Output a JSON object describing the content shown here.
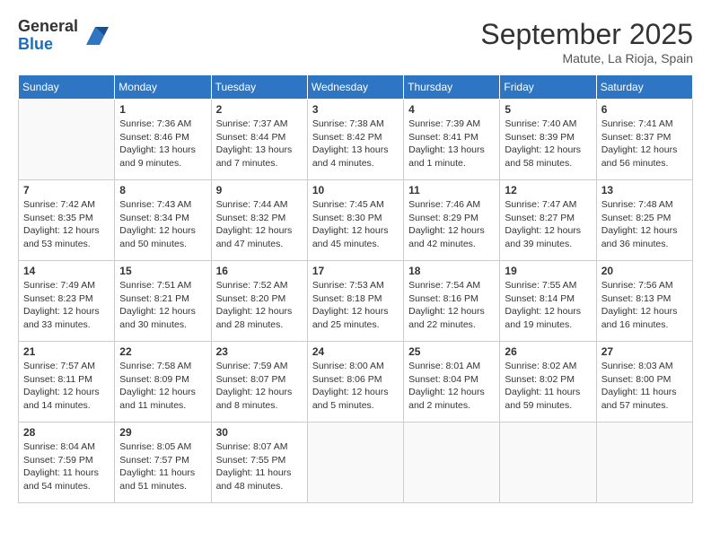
{
  "header": {
    "logo_general": "General",
    "logo_blue": "Blue",
    "month_title": "September 2025",
    "location": "Matute, La Rioja, Spain"
  },
  "calendar": {
    "days_of_week": [
      "Sunday",
      "Monday",
      "Tuesday",
      "Wednesday",
      "Thursday",
      "Friday",
      "Saturday"
    ],
    "weeks": [
      [
        {
          "day": "",
          "empty": true
        },
        {
          "day": "1",
          "sunrise": "Sunrise: 7:36 AM",
          "sunset": "Sunset: 8:46 PM",
          "daylight": "Daylight: 13 hours and 9 minutes."
        },
        {
          "day": "2",
          "sunrise": "Sunrise: 7:37 AM",
          "sunset": "Sunset: 8:44 PM",
          "daylight": "Daylight: 13 hours and 7 minutes."
        },
        {
          "day": "3",
          "sunrise": "Sunrise: 7:38 AM",
          "sunset": "Sunset: 8:42 PM",
          "daylight": "Daylight: 13 hours and 4 minutes."
        },
        {
          "day": "4",
          "sunrise": "Sunrise: 7:39 AM",
          "sunset": "Sunset: 8:41 PM",
          "daylight": "Daylight: 13 hours and 1 minute."
        },
        {
          "day": "5",
          "sunrise": "Sunrise: 7:40 AM",
          "sunset": "Sunset: 8:39 PM",
          "daylight": "Daylight: 12 hours and 58 minutes."
        },
        {
          "day": "6",
          "sunrise": "Sunrise: 7:41 AM",
          "sunset": "Sunset: 8:37 PM",
          "daylight": "Daylight: 12 hours and 56 minutes."
        }
      ],
      [
        {
          "day": "7",
          "sunrise": "Sunrise: 7:42 AM",
          "sunset": "Sunset: 8:35 PM",
          "daylight": "Daylight: 12 hours and 53 minutes."
        },
        {
          "day": "8",
          "sunrise": "Sunrise: 7:43 AM",
          "sunset": "Sunset: 8:34 PM",
          "daylight": "Daylight: 12 hours and 50 minutes."
        },
        {
          "day": "9",
          "sunrise": "Sunrise: 7:44 AM",
          "sunset": "Sunset: 8:32 PM",
          "daylight": "Daylight: 12 hours and 47 minutes."
        },
        {
          "day": "10",
          "sunrise": "Sunrise: 7:45 AM",
          "sunset": "Sunset: 8:30 PM",
          "daylight": "Daylight: 12 hours and 45 minutes."
        },
        {
          "day": "11",
          "sunrise": "Sunrise: 7:46 AM",
          "sunset": "Sunset: 8:29 PM",
          "daylight": "Daylight: 12 hours and 42 minutes."
        },
        {
          "day": "12",
          "sunrise": "Sunrise: 7:47 AM",
          "sunset": "Sunset: 8:27 PM",
          "daylight": "Daylight: 12 hours and 39 minutes."
        },
        {
          "day": "13",
          "sunrise": "Sunrise: 7:48 AM",
          "sunset": "Sunset: 8:25 PM",
          "daylight": "Daylight: 12 hours and 36 minutes."
        }
      ],
      [
        {
          "day": "14",
          "sunrise": "Sunrise: 7:49 AM",
          "sunset": "Sunset: 8:23 PM",
          "daylight": "Daylight: 12 hours and 33 minutes."
        },
        {
          "day": "15",
          "sunrise": "Sunrise: 7:51 AM",
          "sunset": "Sunset: 8:21 PM",
          "daylight": "Daylight: 12 hours and 30 minutes."
        },
        {
          "day": "16",
          "sunrise": "Sunrise: 7:52 AM",
          "sunset": "Sunset: 8:20 PM",
          "daylight": "Daylight: 12 hours and 28 minutes."
        },
        {
          "day": "17",
          "sunrise": "Sunrise: 7:53 AM",
          "sunset": "Sunset: 8:18 PM",
          "daylight": "Daylight: 12 hours and 25 minutes."
        },
        {
          "day": "18",
          "sunrise": "Sunrise: 7:54 AM",
          "sunset": "Sunset: 8:16 PM",
          "daylight": "Daylight: 12 hours and 22 minutes."
        },
        {
          "day": "19",
          "sunrise": "Sunrise: 7:55 AM",
          "sunset": "Sunset: 8:14 PM",
          "daylight": "Daylight: 12 hours and 19 minutes."
        },
        {
          "day": "20",
          "sunrise": "Sunrise: 7:56 AM",
          "sunset": "Sunset: 8:13 PM",
          "daylight": "Daylight: 12 hours and 16 minutes."
        }
      ],
      [
        {
          "day": "21",
          "sunrise": "Sunrise: 7:57 AM",
          "sunset": "Sunset: 8:11 PM",
          "daylight": "Daylight: 12 hours and 14 minutes."
        },
        {
          "day": "22",
          "sunrise": "Sunrise: 7:58 AM",
          "sunset": "Sunset: 8:09 PM",
          "daylight": "Daylight: 12 hours and 11 minutes."
        },
        {
          "day": "23",
          "sunrise": "Sunrise: 7:59 AM",
          "sunset": "Sunset: 8:07 PM",
          "daylight": "Daylight: 12 hours and 8 minutes."
        },
        {
          "day": "24",
          "sunrise": "Sunrise: 8:00 AM",
          "sunset": "Sunset: 8:06 PM",
          "daylight": "Daylight: 12 hours and 5 minutes."
        },
        {
          "day": "25",
          "sunrise": "Sunrise: 8:01 AM",
          "sunset": "Sunset: 8:04 PM",
          "daylight": "Daylight: 12 hours and 2 minutes."
        },
        {
          "day": "26",
          "sunrise": "Sunrise: 8:02 AM",
          "sunset": "Sunset: 8:02 PM",
          "daylight": "Daylight: 11 hours and 59 minutes."
        },
        {
          "day": "27",
          "sunrise": "Sunrise: 8:03 AM",
          "sunset": "Sunset: 8:00 PM",
          "daylight": "Daylight: 11 hours and 57 minutes."
        }
      ],
      [
        {
          "day": "28",
          "sunrise": "Sunrise: 8:04 AM",
          "sunset": "Sunset: 7:59 PM",
          "daylight": "Daylight: 11 hours and 54 minutes."
        },
        {
          "day": "29",
          "sunrise": "Sunrise: 8:05 AM",
          "sunset": "Sunset: 7:57 PM",
          "daylight": "Daylight: 11 hours and 51 minutes."
        },
        {
          "day": "30",
          "sunrise": "Sunrise: 8:07 AM",
          "sunset": "Sunset: 7:55 PM",
          "daylight": "Daylight: 11 hours and 48 minutes."
        },
        {
          "day": "",
          "empty": true
        },
        {
          "day": "",
          "empty": true
        },
        {
          "day": "",
          "empty": true
        },
        {
          "day": "",
          "empty": true
        }
      ]
    ]
  }
}
